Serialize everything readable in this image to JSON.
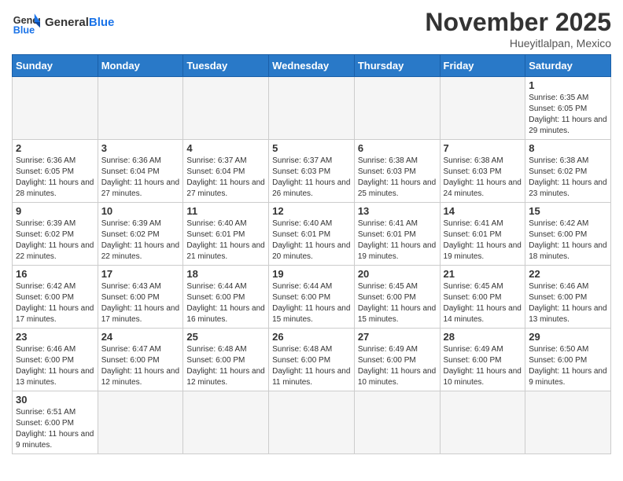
{
  "header": {
    "logo_general": "General",
    "logo_blue": "Blue",
    "month_title": "November 2025",
    "location": "Hueyitlalpan, Mexico"
  },
  "weekdays": [
    "Sunday",
    "Monday",
    "Tuesday",
    "Wednesday",
    "Thursday",
    "Friday",
    "Saturday"
  ],
  "weeks": [
    [
      {
        "day": null
      },
      {
        "day": null
      },
      {
        "day": null
      },
      {
        "day": null
      },
      {
        "day": null
      },
      {
        "day": null
      },
      {
        "day": 1,
        "sunrise": "Sunrise: 6:35 AM",
        "sunset": "Sunset: 6:05 PM",
        "daylight": "Daylight: 11 hours and 29 minutes."
      }
    ],
    [
      {
        "day": 2,
        "sunrise": "Sunrise: 6:36 AM",
        "sunset": "Sunset: 6:05 PM",
        "daylight": "Daylight: 11 hours and 28 minutes."
      },
      {
        "day": 3,
        "sunrise": "Sunrise: 6:36 AM",
        "sunset": "Sunset: 6:04 PM",
        "daylight": "Daylight: 11 hours and 27 minutes."
      },
      {
        "day": 4,
        "sunrise": "Sunrise: 6:37 AM",
        "sunset": "Sunset: 6:04 PM",
        "daylight": "Daylight: 11 hours and 27 minutes."
      },
      {
        "day": 5,
        "sunrise": "Sunrise: 6:37 AM",
        "sunset": "Sunset: 6:03 PM",
        "daylight": "Daylight: 11 hours and 26 minutes."
      },
      {
        "day": 6,
        "sunrise": "Sunrise: 6:38 AM",
        "sunset": "Sunset: 6:03 PM",
        "daylight": "Daylight: 11 hours and 25 minutes."
      },
      {
        "day": 7,
        "sunrise": "Sunrise: 6:38 AM",
        "sunset": "Sunset: 6:03 PM",
        "daylight": "Daylight: 11 hours and 24 minutes."
      },
      {
        "day": 8,
        "sunrise": "Sunrise: 6:38 AM",
        "sunset": "Sunset: 6:02 PM",
        "daylight": "Daylight: 11 hours and 23 minutes."
      }
    ],
    [
      {
        "day": 9,
        "sunrise": "Sunrise: 6:39 AM",
        "sunset": "Sunset: 6:02 PM",
        "daylight": "Daylight: 11 hours and 22 minutes."
      },
      {
        "day": 10,
        "sunrise": "Sunrise: 6:39 AM",
        "sunset": "Sunset: 6:02 PM",
        "daylight": "Daylight: 11 hours and 22 minutes."
      },
      {
        "day": 11,
        "sunrise": "Sunrise: 6:40 AM",
        "sunset": "Sunset: 6:01 PM",
        "daylight": "Daylight: 11 hours and 21 minutes."
      },
      {
        "day": 12,
        "sunrise": "Sunrise: 6:40 AM",
        "sunset": "Sunset: 6:01 PM",
        "daylight": "Daylight: 11 hours and 20 minutes."
      },
      {
        "day": 13,
        "sunrise": "Sunrise: 6:41 AM",
        "sunset": "Sunset: 6:01 PM",
        "daylight": "Daylight: 11 hours and 19 minutes."
      },
      {
        "day": 14,
        "sunrise": "Sunrise: 6:41 AM",
        "sunset": "Sunset: 6:01 PM",
        "daylight": "Daylight: 11 hours and 19 minutes."
      },
      {
        "day": 15,
        "sunrise": "Sunrise: 6:42 AM",
        "sunset": "Sunset: 6:00 PM",
        "daylight": "Daylight: 11 hours and 18 minutes."
      }
    ],
    [
      {
        "day": 16,
        "sunrise": "Sunrise: 6:42 AM",
        "sunset": "Sunset: 6:00 PM",
        "daylight": "Daylight: 11 hours and 17 minutes."
      },
      {
        "day": 17,
        "sunrise": "Sunrise: 6:43 AM",
        "sunset": "Sunset: 6:00 PM",
        "daylight": "Daylight: 11 hours and 17 minutes."
      },
      {
        "day": 18,
        "sunrise": "Sunrise: 6:44 AM",
        "sunset": "Sunset: 6:00 PM",
        "daylight": "Daylight: 11 hours and 16 minutes."
      },
      {
        "day": 19,
        "sunrise": "Sunrise: 6:44 AM",
        "sunset": "Sunset: 6:00 PM",
        "daylight": "Daylight: 11 hours and 15 minutes."
      },
      {
        "day": 20,
        "sunrise": "Sunrise: 6:45 AM",
        "sunset": "Sunset: 6:00 PM",
        "daylight": "Daylight: 11 hours and 15 minutes."
      },
      {
        "day": 21,
        "sunrise": "Sunrise: 6:45 AM",
        "sunset": "Sunset: 6:00 PM",
        "daylight": "Daylight: 11 hours and 14 minutes."
      },
      {
        "day": 22,
        "sunrise": "Sunrise: 6:46 AM",
        "sunset": "Sunset: 6:00 PM",
        "daylight": "Daylight: 11 hours and 13 minutes."
      }
    ],
    [
      {
        "day": 23,
        "sunrise": "Sunrise: 6:46 AM",
        "sunset": "Sunset: 6:00 PM",
        "daylight": "Daylight: 11 hours and 13 minutes."
      },
      {
        "day": 24,
        "sunrise": "Sunrise: 6:47 AM",
        "sunset": "Sunset: 6:00 PM",
        "daylight": "Daylight: 11 hours and 12 minutes."
      },
      {
        "day": 25,
        "sunrise": "Sunrise: 6:48 AM",
        "sunset": "Sunset: 6:00 PM",
        "daylight": "Daylight: 11 hours and 12 minutes."
      },
      {
        "day": 26,
        "sunrise": "Sunrise: 6:48 AM",
        "sunset": "Sunset: 6:00 PM",
        "daylight": "Daylight: 11 hours and 11 minutes."
      },
      {
        "day": 27,
        "sunrise": "Sunrise: 6:49 AM",
        "sunset": "Sunset: 6:00 PM",
        "daylight": "Daylight: 11 hours and 10 minutes."
      },
      {
        "day": 28,
        "sunrise": "Sunrise: 6:49 AM",
        "sunset": "Sunset: 6:00 PM",
        "daylight": "Daylight: 11 hours and 10 minutes."
      },
      {
        "day": 29,
        "sunrise": "Sunrise: 6:50 AM",
        "sunset": "Sunset: 6:00 PM",
        "daylight": "Daylight: 11 hours and 9 minutes."
      }
    ],
    [
      {
        "day": 30,
        "sunrise": "Sunrise: 6:51 AM",
        "sunset": "Sunset: 6:00 PM",
        "daylight": "Daylight: 11 hours and 9 minutes."
      },
      {
        "day": null
      },
      {
        "day": null
      },
      {
        "day": null
      },
      {
        "day": null
      },
      {
        "day": null
      },
      {
        "day": null
      }
    ]
  ]
}
